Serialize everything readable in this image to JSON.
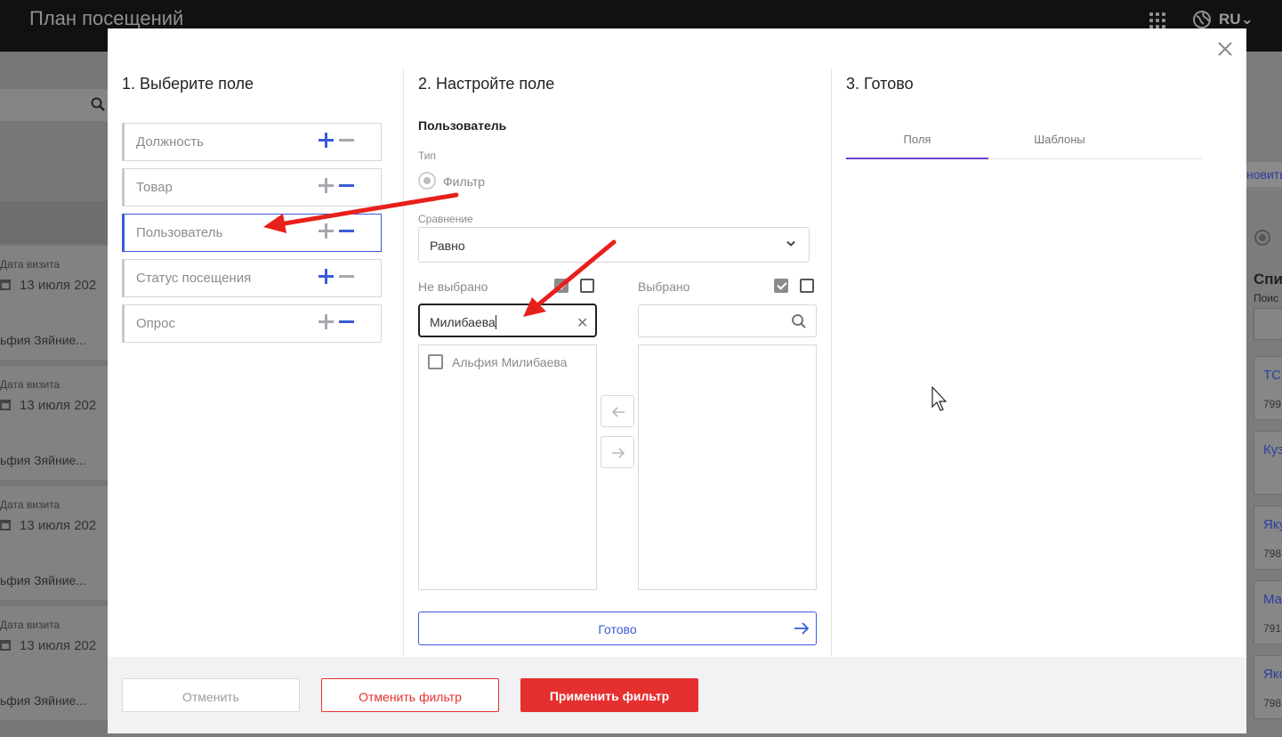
{
  "app": {
    "title": "План посещений",
    "lang": "RU"
  },
  "background": {
    "cards": [
      {
        "label": "Дата визита",
        "date": "13 июля 202",
        "name": "ьфия Зяйние..."
      },
      {
        "label": "Дата визита",
        "date": "13 июля 202",
        "name": "ьфия Зяйние..."
      },
      {
        "label": "Дата визита",
        "date": "13 июля 202",
        "name": "ьфия Зяйние..."
      },
      {
        "label": "Дата визита",
        "date": "13 июля 202",
        "name": "ьфия Зяйние..."
      }
    ],
    "right": {
      "update": "новить",
      "list_title": "Спи",
      "search_lbl": "Поис",
      "cards": [
        {
          "a": "ТС",
          "b": "799"
        },
        {
          "a": "Куз",
          "b": ""
        },
        {
          "a": "Яку",
          "b": "798"
        },
        {
          "a": "Ма",
          "b": "791"
        },
        {
          "a": "Яко",
          "b": "798"
        }
      ]
    }
  },
  "modal": {
    "col1": {
      "title": "1. Выберите поле",
      "fields": [
        {
          "label": "Должность"
        },
        {
          "label": "Товар"
        },
        {
          "label": "Пользователь"
        },
        {
          "label": "Статус посещения"
        },
        {
          "label": "Опрос"
        }
      ]
    },
    "col2": {
      "title": "2. Настройте поле",
      "subtitle": "Пользователь",
      "type_label": "Тип",
      "type_value": "Фильтр",
      "compare_label": "Сравнение",
      "compare_value": "Равно",
      "not_selected_label": "Не выбрано",
      "selected_label": "Выбрано",
      "search_value": "Милибаева",
      "list_items": [
        {
          "label": "Альфия Милибаева"
        }
      ],
      "ready_label": "Готово"
    },
    "col3": {
      "title": "3. Готово",
      "tabs": [
        {
          "label": "Поля"
        },
        {
          "label": "Шаблоны"
        }
      ]
    },
    "footer": {
      "cancel": "Отменить",
      "reset": "Отменить фильтр",
      "apply": "Применить фильтр"
    }
  },
  "colors": {
    "accent_blue": "#3a5bd9",
    "accent_red": "#e5302f",
    "tab_purple": "#6f3fd1",
    "annotation_arrow": "#e8201b"
  }
}
